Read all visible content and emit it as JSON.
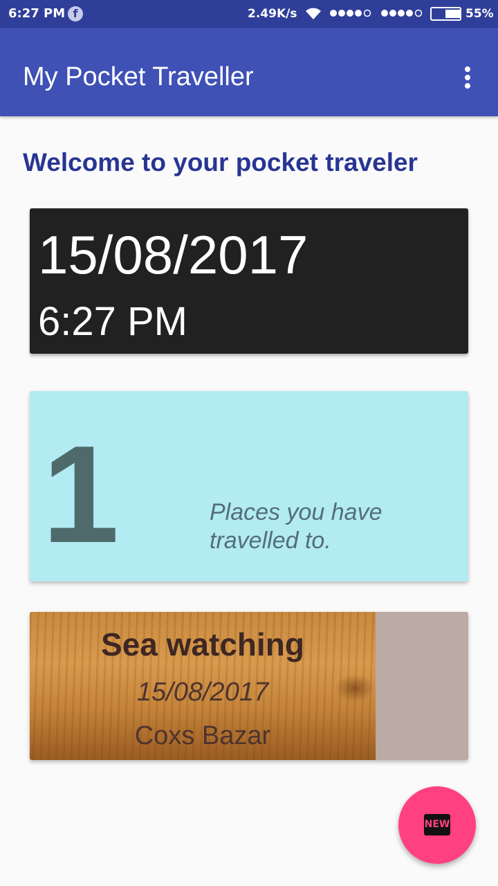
{
  "status_bar": {
    "time": "6:27 PM",
    "notification_icon": "facebook-icon",
    "network_speed": "2.49K/s",
    "battery": "55%",
    "battery_level": 0.55
  },
  "app_bar": {
    "title": "My Pocket Traveller",
    "menu_icon": "overflow-menu-icon"
  },
  "welcome_text": "Welcome to your pocket traveler",
  "clock": {
    "date": "15/08/2017",
    "time": "6:27 PM"
  },
  "places": {
    "count": "1",
    "label": "Places you have travelled to."
  },
  "trip": {
    "title": "Sea watching",
    "date": "15/08/2017",
    "place": "Coxs Bazar"
  },
  "fab": {
    "label": "NEW",
    "icon": "new-badge-icon"
  },
  "colors": {
    "primary": "#3f51b5",
    "primary_dark": "#2f3e99",
    "accent": "#ff4081",
    "places_card": "#b2ebf2"
  }
}
